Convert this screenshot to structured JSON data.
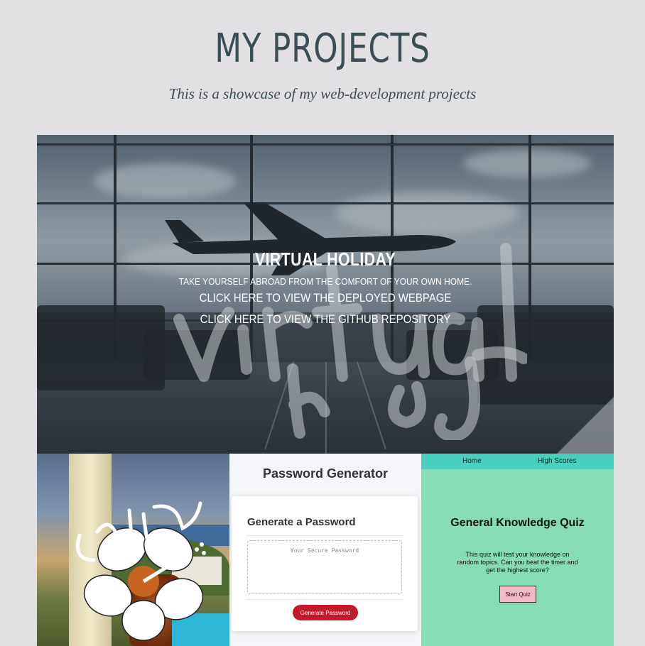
{
  "header": {
    "title": "MY PROJECTS",
    "subtitle": "This is a showcase of my web-development projects"
  },
  "featured_project": {
    "title": "VIRTUAL HOLIDAY",
    "description": "TAKE YOURSELF ABROAD FROM THE COMFORT OF YOUR OWN HOME.",
    "deployed_link": "CLICK HERE TO VIEW THE DEPLOYED WEBPAGE",
    "github_link": "CLICK HERE TO VIEW THE GITHUB REPOSITORY",
    "logo_text": "virtual holiday"
  },
  "projects": {
    "sophia": {
      "logo_text": "sophia"
    },
    "password_generator": {
      "page_title": "Password Generator",
      "card_title": "Generate a Password",
      "textarea_placeholder": "Your Secure Password",
      "button_label": "Generate Password",
      "button_color": "#c21a2a"
    },
    "quiz": {
      "nav_home": "Home",
      "nav_high_scores": "High Scores",
      "title": "General Knowledge Quiz",
      "description": "This quiz will test your knowledge on random topics. Can you beat the timer and get the highest score?",
      "button_label": "Start Quiz",
      "background_color": "#86dcb5",
      "nav_color": "#48cfbd"
    }
  },
  "colors": {
    "page_background": "#e2e0e3",
    "heading": "#3b4e55"
  }
}
